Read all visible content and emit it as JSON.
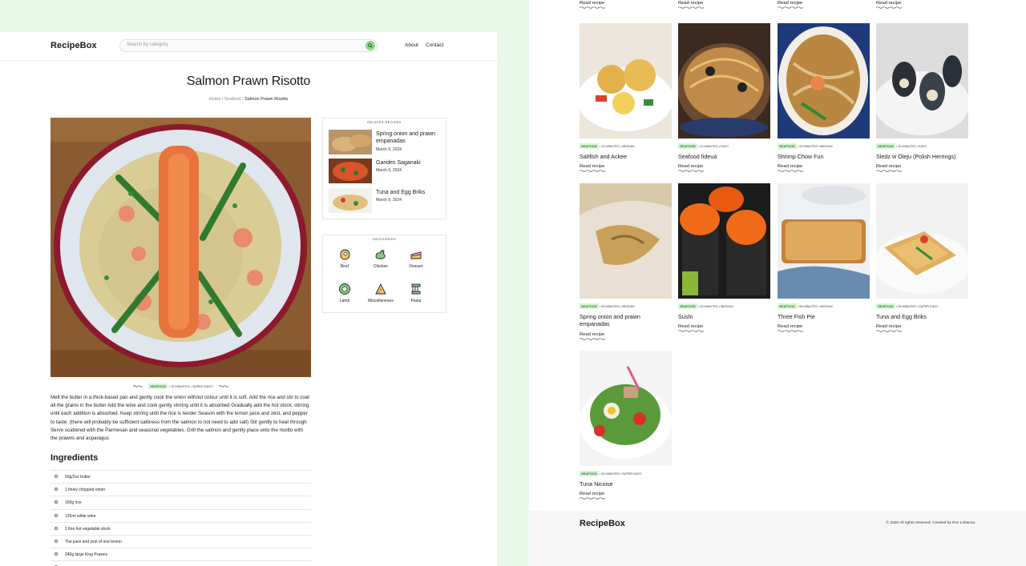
{
  "header": {
    "logo": "RecipeBox",
    "search_placeholder": "Search by category",
    "nav": [
      "About",
      "Contact"
    ]
  },
  "recipe": {
    "title": "Salmon Prawn Risotto",
    "breadcrumb": [
      "Home",
      "Seafood",
      "Salmon Prawn Risotto"
    ],
    "meta": {
      "category": "SEAFOOD",
      "time": "15 MINUTES",
      "difficulty": "SUPER EASY"
    },
    "description": "Melt the butter in a thick-based pan and gently cook the onion without colour until it is soft. Add the rice and stir to coat all the grains in the butter Add the wine and cook gently stirring until it is absorbed Gradually add the hot stock, stirring until each addition is absorbed. Keep stirring until the rice is tender Season with the lemon juice and zest, and pepper to taste. (there will probably be sufficient saltiness from the salmon to not need to add salt) Stir gently to heat through Serve scattered with the Parmesan and seasonal vegetables. Grill the salmon and gently place onto the risotto with the prawns and asparagus",
    "ingredients_title": "Ingredients",
    "ingredients": [
      "50g/2oz butter",
      "1 finely chopped onion",
      "150g rice",
      "125ml white wine",
      "1 litre hot vegetable stock",
      "The juice and zest of one lemon",
      "240g large King Prawns"
    ]
  },
  "related": {
    "title": "RELATED RECIPES",
    "items": [
      {
        "name": "Spring onion and prawn empanadas",
        "date": "March 9, 2024"
      },
      {
        "name": "Garides Saganaki",
        "date": "March 9, 2024"
      },
      {
        "name": "Tuna and Egg Briks",
        "date": "March 9, 2024"
      }
    ]
  },
  "categories": {
    "title": "CATEGORIES",
    "items": [
      "Beef",
      "Chicken",
      "Dessert",
      "Lamb",
      "Miscellaneous",
      "Pasta"
    ]
  },
  "grid": {
    "read_label": "Read recipe",
    "cards": [
      {
        "name": "Saltfish and Ackee",
        "category": "SEAFOOD",
        "time": "30 MINUTES",
        "difficulty": "MEDIUM"
      },
      {
        "name": "Seafood fideuà",
        "category": "SEAFOOD",
        "time": "20 MINUTES",
        "difficulty": "EASY"
      },
      {
        "name": "Shrimp Chow Fun",
        "category": "SEAFOOD",
        "time": "20 MINUTES",
        "difficulty": "MEDIUM"
      },
      {
        "name": "Sledz w Oleju (Polish Herrings)",
        "category": "SEAFOOD",
        "time": "30 MINUTES",
        "difficulty": "EASY"
      },
      {
        "name": "Spring onion and prawn empanadas",
        "category": "SEAFOOD",
        "time": "50 MINUTES",
        "difficulty": "MEDIUM"
      },
      {
        "name": "Sushi",
        "category": "SEAFOOD",
        "time": "45 MINUTES",
        "difficulty": "MEDIUM"
      },
      {
        "name": "Three Fish Pie",
        "category": "SEAFOOD",
        "time": "55 MINUTES",
        "difficulty": "MEDIUM"
      },
      {
        "name": "Tuna and Egg Briks",
        "category": "SEAFOOD",
        "time": "35 MINUTES",
        "difficulty": "SUPER EASY"
      },
      {
        "name": "Tuna Nicoise",
        "category": "SEAFOOD",
        "time": "30 MINUTES",
        "difficulty": "SUPER EASY"
      }
    ]
  },
  "footer": {
    "logo": "RecipeBox",
    "copyright": "© 2025 All rights reserved. Created by Ihor Lobanov."
  },
  "colors": {
    "accent": "#8fd48f",
    "background": "#eafaea",
    "tag": "#d9f2d9"
  }
}
